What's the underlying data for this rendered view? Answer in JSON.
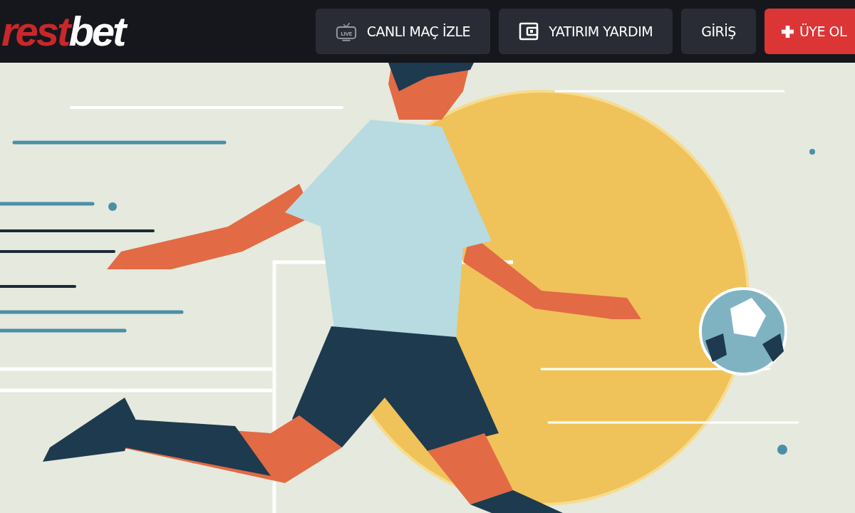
{
  "header": {
    "logo": {
      "first_part": "rest",
      "second_part": "bet"
    },
    "buttons": [
      {
        "kind": "live",
        "label": "CANLI MAÇ İZLE",
        "icon_text": "LIVE"
      },
      {
        "kind": "wallet",
        "label": "YATIRIM YARDIM"
      },
      {
        "kind": "plain",
        "label": "GİRİŞ"
      },
      {
        "kind": "primary",
        "label": "ÜYE OL"
      }
    ]
  },
  "hero": {
    "kind": "illustration"
  }
}
